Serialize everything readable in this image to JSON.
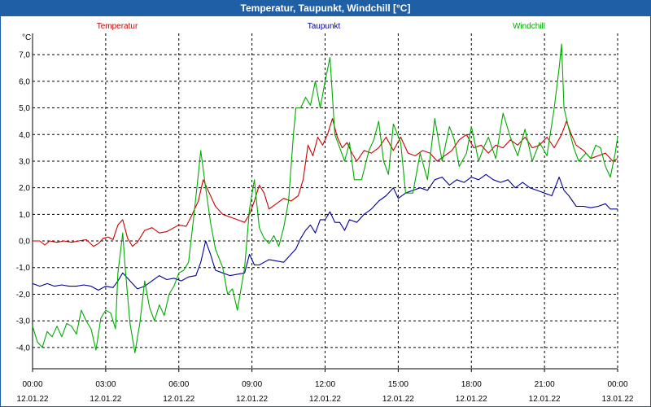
{
  "window": {
    "title": "Temperatur, Taupunkt, Windchill [°C]"
  },
  "chart_data": {
    "type": "line",
    "title": "Temperatur, Taupunkt, Windchill [°C]",
    "ylabel": "°C",
    "ylim": [
      -4.8,
      7.8
    ],
    "y_ticks": [
      7,
      6,
      5,
      4,
      3,
      2,
      1,
      0,
      -1,
      -2,
      -3,
      -4
    ],
    "y_tick_labels": [
      "7,0",
      "6,0",
      "5,0",
      "4,0",
      "3,0",
      "2,0",
      "1,0",
      "0,0",
      "-1,0",
      "-2,0",
      "-3,0",
      "-4,0"
    ],
    "xlim": [
      0,
      24
    ],
    "x_ticks": [
      0,
      3,
      6,
      9,
      12,
      15,
      18,
      21,
      24
    ],
    "x_tick_times": [
      "00:00",
      "03:00",
      "06:00",
      "09:00",
      "12:00",
      "15:00",
      "18:00",
      "21:00",
      "00:00"
    ],
    "x_tick_dates": [
      "12.01.22",
      "12.01.22",
      "12.01.22",
      "12.01.22",
      "12.01.22",
      "12.01.22",
      "12.01.22",
      "12.01.22",
      "13.01.22"
    ],
    "grid": true,
    "legend": "top",
    "colors": {
      "temperatur": "#cc0000",
      "taupunkt": "#000099",
      "windchill": "#00aa00"
    },
    "series": [
      {
        "name": "Temperatur",
        "color": "#cc0000",
        "points": [
          [
            0.0,
            0.0
          ],
          [
            0.3,
            0.0
          ],
          [
            0.5,
            -0.15
          ],
          [
            0.7,
            0.0
          ],
          [
            1.0,
            -0.05
          ],
          [
            1.3,
            0.0
          ],
          [
            1.6,
            -0.05
          ],
          [
            1.9,
            0.0
          ],
          [
            2.2,
            0.05
          ],
          [
            2.5,
            -0.2
          ],
          [
            2.7,
            -0.1
          ],
          [
            2.9,
            0.1
          ],
          [
            3.1,
            0.15
          ],
          [
            3.3,
            0.05
          ],
          [
            3.5,
            0.6
          ],
          [
            3.7,
            0.8
          ],
          [
            3.9,
            0.1
          ],
          [
            4.1,
            -0.2
          ],
          [
            4.3,
            -0.05
          ],
          [
            4.6,
            0.4
          ],
          [
            4.9,
            0.5
          ],
          [
            5.2,
            0.3
          ],
          [
            5.5,
            0.35
          ],
          [
            5.8,
            0.5
          ],
          [
            6.0,
            0.6
          ],
          [
            6.3,
            0.55
          ],
          [
            6.5,
            0.9
          ],
          [
            6.8,
            1.5
          ],
          [
            7.0,
            2.3
          ],
          [
            7.2,
            1.9
          ],
          [
            7.5,
            1.3
          ],
          [
            7.8,
            1.0
          ],
          [
            8.1,
            0.9
          ],
          [
            8.4,
            0.8
          ],
          [
            8.7,
            0.7
          ],
          [
            8.9,
            1.0
          ],
          [
            9.1,
            1.5
          ],
          [
            9.3,
            2.1
          ],
          [
            9.5,
            1.8
          ],
          [
            9.7,
            1.2
          ],
          [
            10.0,
            1.4
          ],
          [
            10.3,
            1.6
          ],
          [
            10.6,
            1.5
          ],
          [
            10.9,
            1.7
          ],
          [
            11.1,
            2.3
          ],
          [
            11.3,
            3.6
          ],
          [
            11.5,
            3.2
          ],
          [
            11.7,
            3.9
          ],
          [
            11.9,
            3.6
          ],
          [
            12.1,
            4.0
          ],
          [
            12.3,
            4.6
          ],
          [
            12.5,
            3.9
          ],
          [
            12.7,
            3.5
          ],
          [
            12.9,
            3.7
          ],
          [
            13.1,
            3.3
          ],
          [
            13.3,
            3.0
          ],
          [
            13.6,
            3.4
          ],
          [
            13.9,
            3.3
          ],
          [
            14.2,
            3.5
          ],
          [
            14.5,
            3.9
          ],
          [
            14.8,
            3.4
          ],
          [
            15.1,
            3.9
          ],
          [
            15.4,
            3.3
          ],
          [
            15.7,
            3.2
          ],
          [
            16.0,
            3.4
          ],
          [
            16.3,
            3.3
          ],
          [
            16.6,
            3.0
          ],
          [
            16.9,
            3.2
          ],
          [
            17.2,
            3.4
          ],
          [
            17.5,
            3.8
          ],
          [
            17.8,
            4.0
          ],
          [
            18.1,
            3.5
          ],
          [
            18.4,
            3.6
          ],
          [
            18.7,
            3.3
          ],
          [
            19.0,
            3.6
          ],
          [
            19.3,
            3.5
          ],
          [
            19.6,
            3.8
          ],
          [
            19.9,
            3.6
          ],
          [
            20.2,
            3.9
          ],
          [
            20.5,
            3.5
          ],
          [
            20.8,
            3.6
          ],
          [
            21.1,
            3.9
          ],
          [
            21.4,
            3.5
          ],
          [
            21.7,
            4.0
          ],
          [
            21.9,
            4.5
          ],
          [
            22.1,
            4.0
          ],
          [
            22.3,
            3.6
          ],
          [
            22.6,
            3.4
          ],
          [
            22.9,
            3.1
          ],
          [
            23.2,
            3.2
          ],
          [
            23.5,
            3.3
          ],
          [
            23.8,
            3.0
          ],
          [
            24.0,
            3.1
          ]
        ]
      },
      {
        "name": "Taupunkt",
        "color": "#000099",
        "points": [
          [
            0.0,
            -1.6
          ],
          [
            0.3,
            -1.7
          ],
          [
            0.6,
            -1.6
          ],
          [
            0.9,
            -1.7
          ],
          [
            1.2,
            -1.65
          ],
          [
            1.5,
            -1.7
          ],
          [
            1.8,
            -1.7
          ],
          [
            2.1,
            -1.65
          ],
          [
            2.4,
            -1.7
          ],
          [
            2.7,
            -1.85
          ],
          [
            3.0,
            -1.7
          ],
          [
            3.3,
            -1.75
          ],
          [
            3.5,
            -1.5
          ],
          [
            3.7,
            -1.2
          ],
          [
            3.9,
            -1.4
          ],
          [
            4.1,
            -1.6
          ],
          [
            4.3,
            -1.8
          ],
          [
            4.6,
            -1.7
          ],
          [
            4.9,
            -1.5
          ],
          [
            5.2,
            -1.3
          ],
          [
            5.5,
            -1.45
          ],
          [
            5.8,
            -1.4
          ],
          [
            6.1,
            -1.5
          ],
          [
            6.4,
            -1.35
          ],
          [
            6.7,
            -1.3
          ],
          [
            6.9,
            -0.8
          ],
          [
            7.1,
            0.0
          ],
          [
            7.3,
            -0.5
          ],
          [
            7.5,
            -1.1
          ],
          [
            7.8,
            -1.2
          ],
          [
            8.1,
            -1.3
          ],
          [
            8.4,
            -1.25
          ],
          [
            8.7,
            -1.2
          ],
          [
            8.9,
            -0.5
          ],
          [
            9.1,
            -0.9
          ],
          [
            9.3,
            -0.9
          ],
          [
            9.5,
            -0.8
          ],
          [
            9.7,
            -0.7
          ],
          [
            10.0,
            -0.75
          ],
          [
            10.3,
            -0.8
          ],
          [
            10.6,
            -0.5
          ],
          [
            10.8,
            -0.3
          ],
          [
            11.0,
            0.1
          ],
          [
            11.2,
            0.4
          ],
          [
            11.4,
            0.6
          ],
          [
            11.6,
            0.3
          ],
          [
            11.8,
            0.8
          ],
          [
            12.0,
            0.8
          ],
          [
            12.2,
            1.1
          ],
          [
            12.4,
            0.7
          ],
          [
            12.6,
            0.7
          ],
          [
            12.8,
            0.4
          ],
          [
            13.0,
            0.8
          ],
          [
            13.3,
            0.7
          ],
          [
            13.6,
            1.0
          ],
          [
            13.9,
            1.2
          ],
          [
            14.2,
            1.5
          ],
          [
            14.5,
            1.7
          ],
          [
            14.8,
            2.0
          ],
          [
            15.0,
            1.6
          ],
          [
            15.3,
            1.8
          ],
          [
            15.6,
            1.9
          ],
          [
            15.9,
            2.0
          ],
          [
            16.2,
            1.9
          ],
          [
            16.5,
            2.3
          ],
          [
            16.8,
            2.4
          ],
          [
            17.1,
            2.1
          ],
          [
            17.4,
            2.3
          ],
          [
            17.7,
            2.2
          ],
          [
            18.0,
            2.4
          ],
          [
            18.3,
            2.3
          ],
          [
            18.6,
            2.5
          ],
          [
            18.9,
            2.3
          ],
          [
            19.2,
            2.2
          ],
          [
            19.5,
            2.3
          ],
          [
            19.8,
            2.0
          ],
          [
            20.1,
            2.2
          ],
          [
            20.4,
            2.0
          ],
          [
            20.7,
            1.9
          ],
          [
            21.0,
            1.8
          ],
          [
            21.3,
            1.7
          ],
          [
            21.6,
            2.4
          ],
          [
            21.8,
            1.9
          ],
          [
            22.0,
            1.7
          ],
          [
            22.3,
            1.3
          ],
          [
            22.6,
            1.3
          ],
          [
            22.9,
            1.25
          ],
          [
            23.2,
            1.3
          ],
          [
            23.5,
            1.4
          ],
          [
            23.7,
            1.2
          ],
          [
            24.0,
            1.2
          ]
        ]
      },
      {
        "name": "Windchill",
        "color": "#00aa00",
        "points": [
          [
            0.0,
            -3.2
          ],
          [
            0.2,
            -3.8
          ],
          [
            0.4,
            -4.0
          ],
          [
            0.6,
            -3.4
          ],
          [
            0.8,
            -3.6
          ],
          [
            1.0,
            -3.2
          ],
          [
            1.2,
            -3.6
          ],
          [
            1.4,
            -3.1
          ],
          [
            1.6,
            -3.2
          ],
          [
            1.8,
            -3.5
          ],
          [
            2.0,
            -2.6
          ],
          [
            2.2,
            -3.0
          ],
          [
            2.4,
            -3.3
          ],
          [
            2.6,
            -4.1
          ],
          [
            2.8,
            -2.9
          ],
          [
            3.0,
            -2.6
          ],
          [
            3.2,
            -2.7
          ],
          [
            3.4,
            -3.3
          ],
          [
            3.5,
            -1.2
          ],
          [
            3.7,
            0.3
          ],
          [
            3.8,
            -1.0
          ],
          [
            4.0,
            -3.1
          ],
          [
            4.2,
            -4.2
          ],
          [
            4.4,
            -3.1
          ],
          [
            4.6,
            -1.5
          ],
          [
            4.8,
            -2.5
          ],
          [
            5.0,
            -3.0
          ],
          [
            5.2,
            -2.4
          ],
          [
            5.4,
            -2.8
          ],
          [
            5.6,
            -2.0
          ],
          [
            5.8,
            -1.7
          ],
          [
            6.0,
            -1.2
          ],
          [
            6.2,
            -1.1
          ],
          [
            6.4,
            -0.8
          ],
          [
            6.6,
            0.8
          ],
          [
            6.8,
            2.5
          ],
          [
            6.9,
            3.4
          ],
          [
            7.1,
            2.0
          ],
          [
            7.3,
            0.7
          ],
          [
            7.5,
            -0.3
          ],
          [
            7.8,
            -1.0
          ],
          [
            8.0,
            -2.0
          ],
          [
            8.2,
            -1.8
          ],
          [
            8.4,
            -2.6
          ],
          [
            8.7,
            -1.0
          ],
          [
            8.9,
            1.2
          ],
          [
            9.1,
            2.3
          ],
          [
            9.3,
            0.5
          ],
          [
            9.5,
            0.1
          ],
          [
            9.7,
            -0.1
          ],
          [
            9.9,
            0.2
          ],
          [
            10.1,
            -0.2
          ],
          [
            10.3,
            0.5
          ],
          [
            10.5,
            1.5
          ],
          [
            10.7,
            4.0
          ],
          [
            10.8,
            5.0
          ],
          [
            11.0,
            5.0
          ],
          [
            11.2,
            5.4
          ],
          [
            11.4,
            5.1
          ],
          [
            11.6,
            6.0
          ],
          [
            11.8,
            5.0
          ],
          [
            12.0,
            6.0
          ],
          [
            12.2,
            6.9
          ],
          [
            12.4,
            4.0
          ],
          [
            12.6,
            3.5
          ],
          [
            12.8,
            3.0
          ],
          [
            13.0,
            3.7
          ],
          [
            13.2,
            2.3
          ],
          [
            13.5,
            2.3
          ],
          [
            13.8,
            3.4
          ],
          [
            14.0,
            3.8
          ],
          [
            14.2,
            4.5
          ],
          [
            14.4,
            3.0
          ],
          [
            14.6,
            2.5
          ],
          [
            14.8,
            4.4
          ],
          [
            15.1,
            3.7
          ],
          [
            15.3,
            1.8
          ],
          [
            15.6,
            1.8
          ],
          [
            15.9,
            3.3
          ],
          [
            16.2,
            2.3
          ],
          [
            16.5,
            4.6
          ],
          [
            16.8,
            3.0
          ],
          [
            17.1,
            4.3
          ],
          [
            17.3,
            3.8
          ],
          [
            17.5,
            2.8
          ],
          [
            17.8,
            3.3
          ],
          [
            18.0,
            4.3
          ],
          [
            18.3,
            3.0
          ],
          [
            18.5,
            3.5
          ],
          [
            18.7,
            3.9
          ],
          [
            19.0,
            3.1
          ],
          [
            19.3,
            4.8
          ],
          [
            19.6,
            3.9
          ],
          [
            19.9,
            3.2
          ],
          [
            20.2,
            4.2
          ],
          [
            20.5,
            3.0
          ],
          [
            20.8,
            3.7
          ],
          [
            21.1,
            3.2
          ],
          [
            21.4,
            5.0
          ],
          [
            21.6,
            6.5
          ],
          [
            21.7,
            7.4
          ],
          [
            21.8,
            5.0
          ],
          [
            22.0,
            4.2
          ],
          [
            22.2,
            3.5
          ],
          [
            22.4,
            3.0
          ],
          [
            22.7,
            3.3
          ],
          [
            22.9,
            3.1
          ],
          [
            23.1,
            3.6
          ],
          [
            23.3,
            3.5
          ],
          [
            23.5,
            2.8
          ],
          [
            23.7,
            2.4
          ],
          [
            23.9,
            3.3
          ],
          [
            24.0,
            3.9
          ]
        ]
      }
    ]
  }
}
